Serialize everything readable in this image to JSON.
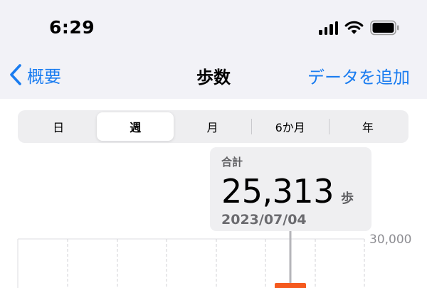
{
  "status_bar": {
    "time": "6:29",
    "icons": [
      "cellular-signal-icon",
      "wifi-icon",
      "battery-icon"
    ]
  },
  "nav": {
    "back_label": "概要",
    "title": "歩数",
    "add_label": "データを追加"
  },
  "segments": [
    {
      "label": "日",
      "selected": false
    },
    {
      "label": "週",
      "selected": true
    },
    {
      "label": "月",
      "selected": false
    },
    {
      "label": "6か月",
      "selected": false
    },
    {
      "label": "年",
      "selected": false
    }
  ],
  "callout": {
    "label": "合計",
    "value": "25,313",
    "unit": "歩",
    "date": "2023/07/04"
  },
  "chart_data": {
    "type": "bar",
    "ylim": [
      0,
      30000
    ],
    "y_tick_labels": [
      "30,000"
    ],
    "selected_category": "2023/07/04",
    "grid": true
  },
  "colors": {
    "accent": "#1a7cf0",
    "bar_highlight": "#f55a1e",
    "background_top": "#f2f2f7"
  }
}
